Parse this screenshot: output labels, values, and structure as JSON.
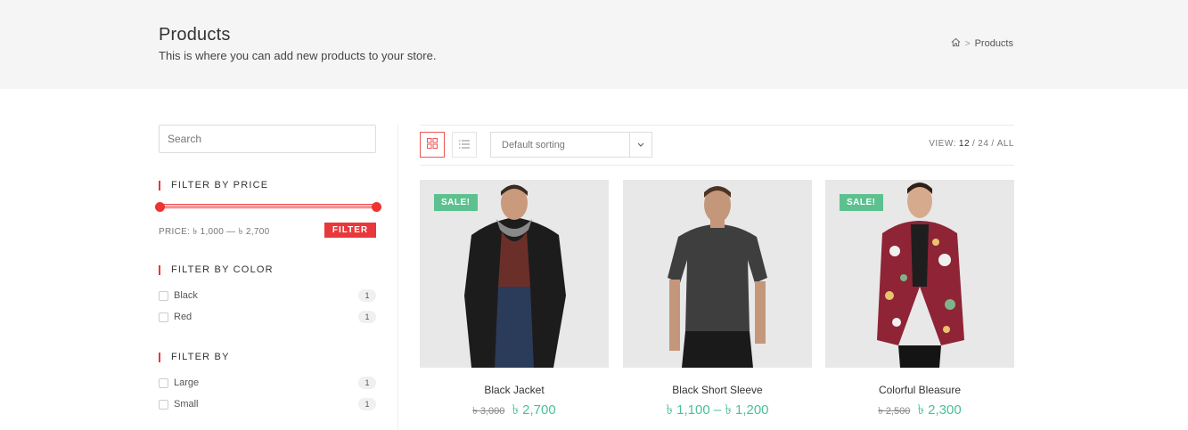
{
  "header": {
    "title": "Products",
    "subtitle": "This is where you can add new products to your store.",
    "breadcrumb": {
      "current": "Products",
      "separator": ">"
    }
  },
  "sidebar": {
    "search_placeholder": "Search",
    "price_widget": {
      "title": "FILTER BY PRICE",
      "label": "PRICE: ৳ 1,000 — ৳ 2,700",
      "button": "FILTER"
    },
    "color_widget": {
      "title": "FILTER BY COLOR",
      "items": [
        {
          "label": "Black",
          "count": "1"
        },
        {
          "label": "Red",
          "count": "1"
        }
      ]
    },
    "size_widget": {
      "title": "FILTER BY",
      "items": [
        {
          "label": "Large",
          "count": "1"
        },
        {
          "label": "Small",
          "count": "1"
        }
      ]
    }
  },
  "toolbar": {
    "sort_label": "Default sorting",
    "view_label": "VIEW:",
    "view_options": [
      "12",
      "/",
      "24",
      "/",
      "ALL"
    ]
  },
  "products": [
    {
      "name": "Black Jacket",
      "badge": "SALE!",
      "old_price": "৳ 3,000",
      "price": "৳ 2,700"
    },
    {
      "name": "Black Short Sleeve",
      "badge": "",
      "old_price": "",
      "price": "৳ 1,100 – ৳ 1,200"
    },
    {
      "name": "Colorful Bleasure",
      "badge": "SALE!",
      "old_price": "৳ 2,500",
      "price": "৳ 2,300"
    }
  ],
  "colors": {
    "accent_red": "#e8383b",
    "sale_green": "#5cc18f",
    "price_green": "#4bbf9b"
  },
  "icons": [
    "home-icon",
    "grid-view-icon",
    "list-view-icon",
    "chevron-down-icon"
  ]
}
